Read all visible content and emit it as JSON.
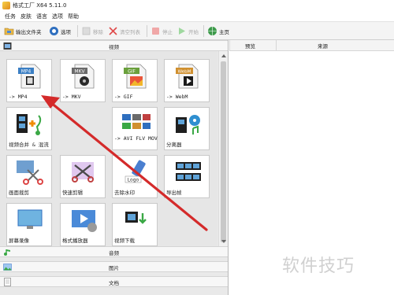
{
  "window": {
    "title": "格式工厂 X64 5.11.0"
  },
  "menu": [
    "任务",
    "皮肤",
    "语言",
    "选项",
    "帮助"
  ],
  "toolbar": {
    "output_folder": "输出文件夹",
    "options": "选项",
    "remove": "移除",
    "clear_list": "清空列表",
    "stop": "停止",
    "start": "开始",
    "home": "主页"
  },
  "categories": {
    "video": "视频",
    "audio": "音频",
    "image": "图片",
    "document": "文档"
  },
  "tiles": [
    {
      "label": "-> MP4",
      "icon": "mp4-file-icon",
      "badge": "MP4",
      "badge_color": "#3b7fc4"
    },
    {
      "label": "-> MKV",
      "icon": "mkv-file-icon",
      "badge": "MKV",
      "badge_color": "#6a6a6a"
    },
    {
      "label": "-> GIF",
      "icon": "gif-file-icon",
      "badge": "GIF",
      "badge_color": "#6aa03c"
    },
    {
      "label": "-> WebM",
      "icon": "webm-file-icon",
      "badge": "WebM",
      "badge_color": "#d0902f"
    },
    {
      "label": "视频合并 & 混流",
      "icon": "video-merge-icon"
    },
    {
      "label": "-> AVI FLV MOV Etc...",
      "icon": "multi-format-icon"
    },
    {
      "label": "分离器",
      "icon": "splitter-icon"
    },
    {
      "label": "画面裁剪",
      "icon": "crop-scissors-icon"
    },
    {
      "label": "快速剪辑",
      "icon": "quick-clip-icon"
    },
    {
      "label": "去除水印",
      "icon": "remove-watermark-icon"
    },
    {
      "label": "导出帧",
      "icon": "export-frames-icon"
    },
    {
      "label": "屏幕录像",
      "icon": "screen-record-icon"
    },
    {
      "label": "格式播放器",
      "icon": "format-player-icon"
    },
    {
      "label": "视频下载",
      "icon": "video-download-icon"
    }
  ],
  "task_list": {
    "col_preview": "预览",
    "col_source": "来源"
  },
  "watermark": "软件技巧",
  "colors": {
    "arrow": "#d42a2a",
    "accent": "#3b7fc4"
  }
}
